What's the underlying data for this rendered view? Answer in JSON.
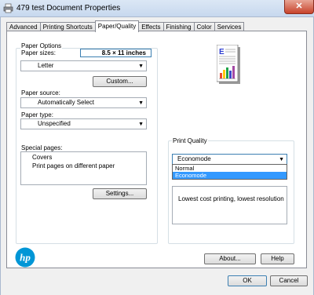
{
  "window": {
    "title": "479 test Document Properties",
    "close_glyph": "✕"
  },
  "tabs": [
    {
      "label": "Advanced"
    },
    {
      "label": "Printing Shortcuts"
    },
    {
      "label": "Paper/Quality",
      "active": true
    },
    {
      "label": "Effects"
    },
    {
      "label": "Finishing"
    },
    {
      "label": "Color"
    },
    {
      "label": "Services"
    }
  ],
  "paper_options": {
    "group_label": "Paper Options",
    "paper_sizes_label": "Paper sizes:",
    "paper_size_value": "8.5 × 11 inches",
    "paper_size_selected": "Letter",
    "custom_button": "Custom...",
    "paper_source_label": "Paper source:",
    "paper_source_selected": "Automatically Select",
    "paper_type_label": "Paper type:",
    "paper_type_selected": "Unspecified"
  },
  "special_pages": {
    "label": "Special pages:",
    "items": [
      "Covers",
      "Print pages on different paper"
    ],
    "settings_button": "Settings..."
  },
  "print_quality": {
    "group_label": "Print Quality",
    "selected": "Economode",
    "options": [
      "Normal",
      "Economode"
    ],
    "highlighted_option": "Economode",
    "description": "Lowest cost printing, lowest resolution"
  },
  "preview": {
    "letter": "E"
  },
  "brand": {
    "logo_text": "hp",
    "color": "#0096d6"
  },
  "bottom_buttons": {
    "about": "About...",
    "help": "Help"
  },
  "dialog_buttons": {
    "ok": "OK",
    "cancel": "Cancel"
  }
}
